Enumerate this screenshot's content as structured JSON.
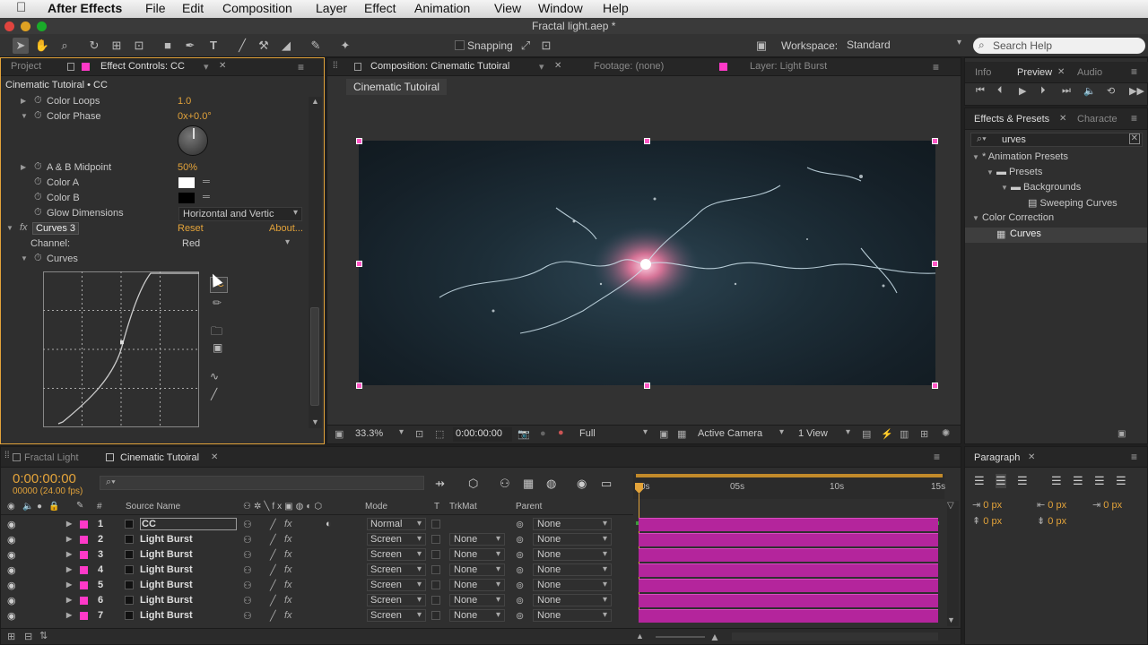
{
  "menubar": {
    "app": "After Effects",
    "items": [
      "File",
      "Edit",
      "Composition",
      "Layer",
      "Effect",
      "Animation",
      "View",
      "Window",
      "Help"
    ]
  },
  "window_title": "Fractal light.aep *",
  "toolbar": {
    "snapping_label": "Snapping",
    "workspace_label": "Workspace:",
    "workspace_value": "Standard",
    "search_placeholder": "Search Help"
  },
  "effect_controls": {
    "tab_project": "Project",
    "tab_title": "Effect Controls: CC",
    "header": "Cinematic Tutoiral • CC",
    "props": [
      {
        "label": "Color Loops",
        "value": "1.0"
      },
      {
        "label": "Color Phase",
        "value": "0x+0.0°"
      },
      {
        "label": "A & B Midpoint",
        "value": "50%"
      },
      {
        "label": "Color A",
        "value": ""
      },
      {
        "label": "Color B",
        "value": ""
      },
      {
        "label": "Glow Dimensions",
        "value": "Horizontal and Vertic"
      }
    ],
    "curves_name": "Curves 3",
    "reset": "Reset",
    "about": "About...",
    "channel_label": "Channel:",
    "channel_value": "Red",
    "curves_label": "Curves"
  },
  "composition": {
    "tab": "Composition: Cinematic Tutoiral",
    "footage_tab": "Footage: (none)",
    "layer_tab": "Layer: Light Burst",
    "breadcrumb": "Cinematic Tutoiral",
    "zoom": "33.3%",
    "timecode": "0:00:00:00",
    "resolution": "Full",
    "camera": "Active Camera",
    "views": "1 View"
  },
  "right_panel": {
    "tabs_top": [
      "Info",
      "Preview",
      "Audio"
    ],
    "effects_tab": "Effects & Presets",
    "character_tab": "Characte",
    "search_value": "urves",
    "tree": [
      {
        "label": "* Animation Presets",
        "level": 0
      },
      {
        "label": "Presets",
        "level": 1
      },
      {
        "label": "Backgrounds",
        "level": 2
      },
      {
        "label": "Sweeping Curves",
        "level": 3
      },
      {
        "label": "Color Correction",
        "level": 0
      },
      {
        "label": "Curves",
        "level": 1
      }
    ],
    "paragraph_tab": "Paragraph",
    "para_values": [
      "0 px",
      "0 px",
      "0 px",
      "0 px",
      "0 px"
    ]
  },
  "timeline": {
    "tab1": "Fractal Light",
    "tab2": "Cinematic Tutoiral",
    "timecode": "0:00:00:00",
    "frames": "00000 (24.00 fps)",
    "col_source": "Source Name",
    "col_mode": "Mode",
    "col_t": "T",
    "col_trkmat": "TrkMat",
    "col_parent": "Parent",
    "ruler": [
      "0s",
      "05s",
      "10s",
      "15s"
    ],
    "layers": [
      {
        "num": "1",
        "name": "CC",
        "mode": "Normal",
        "trkmat": "",
        "parent": "None"
      },
      {
        "num": "2",
        "name": "Light Burst",
        "mode": "Screen",
        "trkmat": "None",
        "parent": "None"
      },
      {
        "num": "3",
        "name": "Light Burst",
        "mode": "Screen",
        "trkmat": "None",
        "parent": "None"
      },
      {
        "num": "4",
        "name": "Light Burst",
        "mode": "Screen",
        "trkmat": "None",
        "parent": "None"
      },
      {
        "num": "5",
        "name": "Light Burst",
        "mode": "Screen",
        "trkmat": "None",
        "parent": "None"
      },
      {
        "num": "6",
        "name": "Light Burst",
        "mode": "Screen",
        "trkmat": "None",
        "parent": "None"
      },
      {
        "num": "7",
        "name": "Light Burst",
        "mode": "Screen",
        "trkmat": "None",
        "parent": "None"
      }
    ]
  }
}
